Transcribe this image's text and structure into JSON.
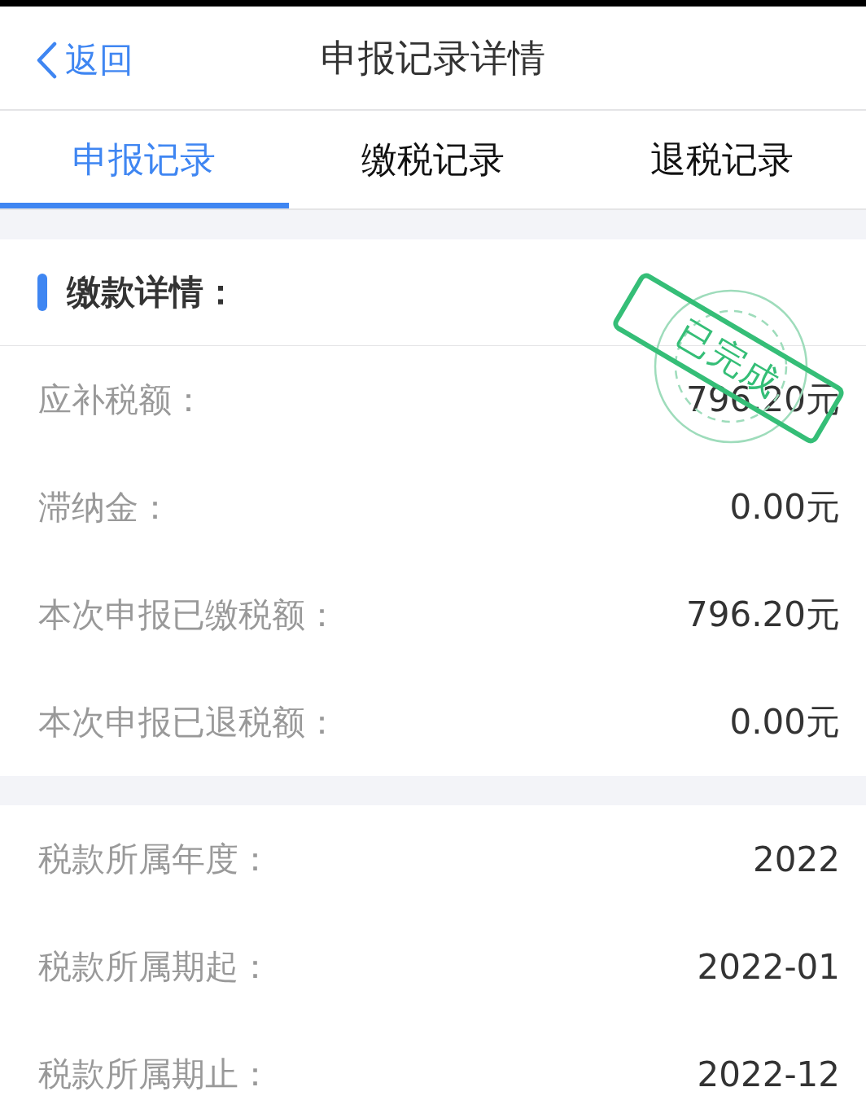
{
  "header": {
    "back_label": "返回",
    "title": "申报记录详情"
  },
  "tabs": [
    {
      "label": "申报记录",
      "selected": true
    },
    {
      "label": "缴税记录",
      "selected": false
    },
    {
      "label": "退税记录",
      "selected": false
    }
  ],
  "sections": [
    {
      "title": "缴款详情：",
      "stamp": {
        "text": "已完成"
      },
      "rows": [
        {
          "label": "应补税额：",
          "value": "796.20元"
        },
        {
          "label": "滞纳金：",
          "value": "0.00元"
        },
        {
          "label": "本次申报已缴税额：",
          "value": "796.20元"
        },
        {
          "label": "本次申报已退税额：",
          "value": "0.00元"
        }
      ]
    },
    {
      "rows": [
        {
          "label": "税款所属年度：",
          "value": "2022"
        },
        {
          "label": "税款所属期起：",
          "value": "2022-01"
        },
        {
          "label": "税款所属期止：",
          "value": "2022-12"
        }
      ]
    }
  ]
}
